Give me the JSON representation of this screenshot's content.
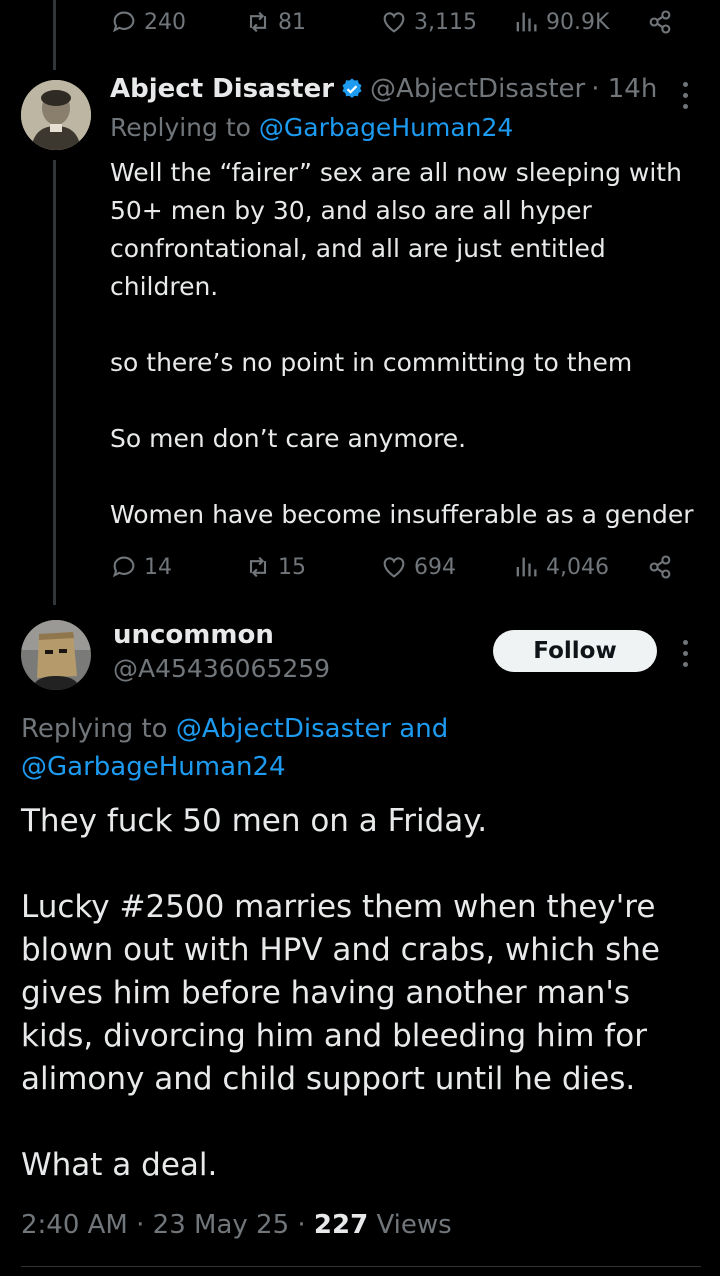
{
  "top_actions": {
    "replies": "240",
    "reposts": "81",
    "likes": "3,115",
    "views": "90.9K"
  },
  "reply_tweet": {
    "display_name": "Abject Disaster",
    "handle": "@AbjectDisaster",
    "time": "· 14h",
    "replying_prefix": "Replying to",
    "replying_to": "@GarbageHuman24",
    "paragraphs": [
      "Well the “fairer” sex are all now sleeping with 50+ men by 30, and also are all hyper confrontational, and all are just entitled children.",
      "so there’s no point in committing to them",
      "So men don’t care anymore.",
      "Women have become insufferable as a gender"
    ],
    "replies": "14",
    "reposts": "15",
    "likes": "694",
    "views": "4,046"
  },
  "main_tweet": {
    "display_name": "uncommon",
    "handle": "@A45436065259",
    "follow_label": "Follow",
    "replying_prefix": "Replying to",
    "replying_to_1": "@AbjectDisaster",
    "replying_and": "and",
    "replying_to_2": "@GarbageHuman24",
    "paragraphs": [
      "They fuck 50 men on a Friday.",
      "Lucky #2500 marries them when they're blown out with HPV and crabs, which she gives him before having another man's kids, divorcing him and bleeding him for alimony and child support until he dies.",
      "What a deal."
    ],
    "time": "2:40 AM",
    "date": "23 May 25",
    "views_count": "227",
    "views_label": "Views"
  },
  "colors": {
    "accent": "#1d9bf0",
    "text": "#e7e9ea",
    "muted": "#71767b",
    "background": "#000000"
  }
}
